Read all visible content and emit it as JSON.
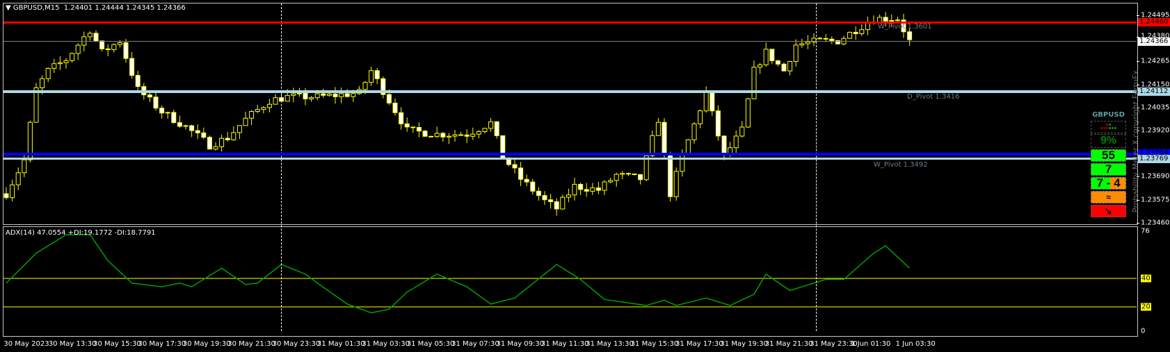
{
  "header": {
    "symbol_tf": "GBPUSD,M15",
    "ohlc": "1.24401 1.24444 1.24345 1.24366"
  },
  "colors": {
    "bull": "#000000",
    "bear": "#ffffff",
    "wick": "#ffff00",
    "adx": "#00a000",
    "red_line": "#ff0000",
    "blue_line": "#0000ff",
    "pivot_line": "#add8e6"
  },
  "price_axis": [
    "1.24495",
    "1.24265",
    "1.24150",
    "1.24035",
    "1.23920",
    "1.23690",
    "1.23575",
    "1.23460"
  ],
  "price_axis_values": [
    1.24495,
    1.24265,
    1.2415,
    1.24035,
    1.2392,
    1.2369,
    1.23575,
    1.2346
  ],
  "hidden_axis_label": "1.24380",
  "levels": [
    {
      "name": "red",
      "price": 1.2446,
      "label": "1.24460"
    },
    {
      "name": "bid",
      "price": 1.24366,
      "label": "1.24366"
    },
    {
      "name": "d-pivot",
      "price": 1.24112,
      "label": "1.24112",
      "text": "D_Pivot 1.3416"
    },
    {
      "name": "blue",
      "price": 1.23794,
      "label": "1.23794"
    },
    {
      "name": "w-pivot",
      "price": 1.23769,
      "label": "1.23769",
      "text": "W_Pivot 1.3492"
    }
  ],
  "w_pivot_top_text": "W_Pivot 1.3601",
  "adx": {
    "title": "ADX(14) 47.0554 +DI:19.1772 -DI:18.7791",
    "axis": [
      "76",
      "40",
      "20",
      "0"
    ],
    "levels": [
      {
        "v": 40,
        "label": "40"
      },
      {
        "v": 20,
        "label": "20"
      }
    ],
    "max": 76
  },
  "time_axis": [
    "30 May 2023",
    "30 May 13:30",
    "30 May 15:30",
    "30 May 17:30",
    "30 May 19:30",
    "30 May 21:30",
    "30 May 23:30",
    "31 May 01:30",
    "31 May 03:30",
    "31 May 05:30",
    "31 May 07:30",
    "31 May 09:30",
    "31 May 11:30",
    "31 May 13:30",
    "31 May 15:30",
    "31 May 17:30",
    "31 May 19:30",
    "31 May 21:30",
    "31 May 23:30",
    "1 Jun 01:30",
    "1 Jun 03:30"
  ],
  "meter": {
    "symbol": "GBPUSD",
    "percent": "9%",
    "v1": "55",
    "v2": "7",
    "v3a": "7",
    "v3sep": "-",
    "v3b": "4",
    "copyright": "Probability Meter X copyright FerruFx"
  },
  "chart_data": {
    "type": "candlestick",
    "title": "GBPUSD,M15",
    "ylim": [
      1.2346,
      1.24495
    ],
    "price_path": [
      [
        0,
        1.23605
      ],
      [
        3,
        1.23772
      ],
      [
        5,
        1.24125
      ],
      [
        7,
        1.24218
      ],
      [
        10,
        1.24274
      ],
      [
        14,
        1.24423
      ],
      [
        16,
        1.24311
      ],
      [
        19,
        1.24367
      ],
      [
        22,
        1.24125
      ],
      [
        26,
        1.24014
      ],
      [
        30,
        1.23939
      ],
      [
        34,
        1.23847
      ],
      [
        37,
        1.23884
      ],
      [
        40,
        1.23976
      ],
      [
        44,
        1.24069
      ],
      [
        47,
        1.24088
      ],
      [
        52,
        1.24088
      ],
      [
        59,
        1.24107
      ],
      [
        61,
        1.24218
      ],
      [
        64,
        1.24069
      ],
      [
        67,
        1.23921
      ],
      [
        72,
        1.23902
      ],
      [
        77,
        1.23902
      ],
      [
        81,
        1.23958
      ],
      [
        83,
        1.23791
      ],
      [
        86,
        1.23679
      ],
      [
        90,
        1.23568
      ],
      [
        92,
        1.23531
      ],
      [
        95,
        1.23642
      ],
      [
        99,
        1.23624
      ],
      [
        102,
        1.23698
      ],
      [
        106,
        1.23679
      ],
      [
        109,
        1.23976
      ],
      [
        111,
        1.23605
      ],
      [
        113,
        1.23791
      ],
      [
        117,
        1.24107
      ],
      [
        120,
        1.23791
      ],
      [
        123,
        1.23921
      ],
      [
        125,
        1.24218
      ],
      [
        127,
        1.24311
      ],
      [
        130,
        1.24218
      ],
      [
        132,
        1.24348
      ],
      [
        136,
        1.24367
      ],
      [
        139,
        1.24367
      ],
      [
        142,
        1.24423
      ],
      [
        145,
        1.24479
      ],
      [
        149,
        1.24479
      ],
      [
        151,
        1.24366
      ]
    ],
    "adx_path": [
      [
        0,
        36.7
      ],
      [
        5,
        57.7
      ],
      [
        10,
        70.7
      ],
      [
        14,
        70.7
      ],
      [
        17,
        52.4
      ],
      [
        21,
        36.7
      ],
      [
        26,
        34.1
      ],
      [
        29,
        36.7
      ],
      [
        31,
        34.1
      ],
      [
        36,
        47.2
      ],
      [
        40,
        35.7
      ],
      [
        42,
        36.7
      ],
      [
        46,
        49.8
      ],
      [
        50,
        43
      ],
      [
        52,
        36.7
      ],
      [
        57,
        22
      ],
      [
        61,
        15.8
      ],
      [
        64,
        18.4
      ],
      [
        67,
        30.4
      ],
      [
        72,
        43
      ],
      [
        77,
        34.1
      ],
      [
        81,
        22
      ],
      [
        85,
        26.2
      ],
      [
        92,
        49.8
      ],
      [
        96,
        39.3
      ],
      [
        100,
        25.2
      ],
      [
        107,
        21
      ],
      [
        110,
        24.7
      ],
      [
        112,
        21
      ],
      [
        117,
        26.2
      ],
      [
        121,
        21
      ],
      [
        125,
        28.9
      ],
      [
        127,
        43
      ],
      [
        131,
        31.5
      ],
      [
        135,
        36.7
      ],
      [
        137,
        39.3
      ],
      [
        140,
        39.3
      ],
      [
        145,
        57.7
      ],
      [
        147,
        62.9
      ],
      [
        151,
        47.2
      ]
    ]
  }
}
